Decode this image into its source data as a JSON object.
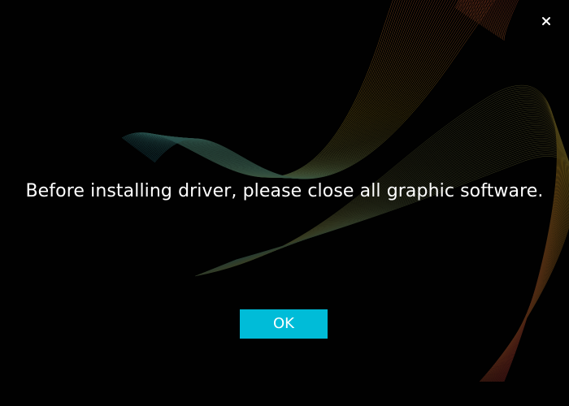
{
  "dialog": {
    "message": "Before installing driver, please close all graphic software.",
    "ok_label": "OK",
    "close_icon": "close-icon"
  },
  "colors": {
    "background": "#010101",
    "accent": "#00bcd8",
    "text": "#ffffff",
    "wave_teal": "#1e8fb0",
    "wave_yellow": "#c8a020",
    "wave_red": "#c02838"
  }
}
